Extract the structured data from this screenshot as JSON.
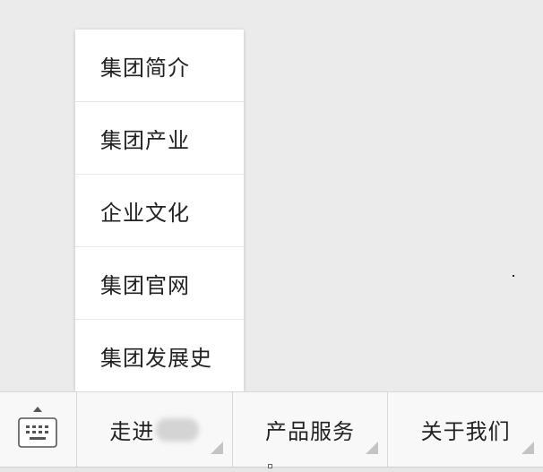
{
  "submenu": {
    "items": [
      {
        "label": "集团简介"
      },
      {
        "label": "集团产业"
      },
      {
        "label": "企业文化"
      },
      {
        "label": "集团官网"
      },
      {
        "label": "集团发展史"
      }
    ]
  },
  "bottom_bar": {
    "keyboard_icon": "keyboard-icon",
    "menus": [
      {
        "label": "走进"
      },
      {
        "label": "产品服务"
      },
      {
        "label": "关于我们"
      }
    ]
  },
  "colors": {
    "background": "#ebebeb",
    "bar_background": "#f8f8f8",
    "menu_background": "#ffffff",
    "text": "#222222",
    "divider": "#d8d8d8"
  }
}
